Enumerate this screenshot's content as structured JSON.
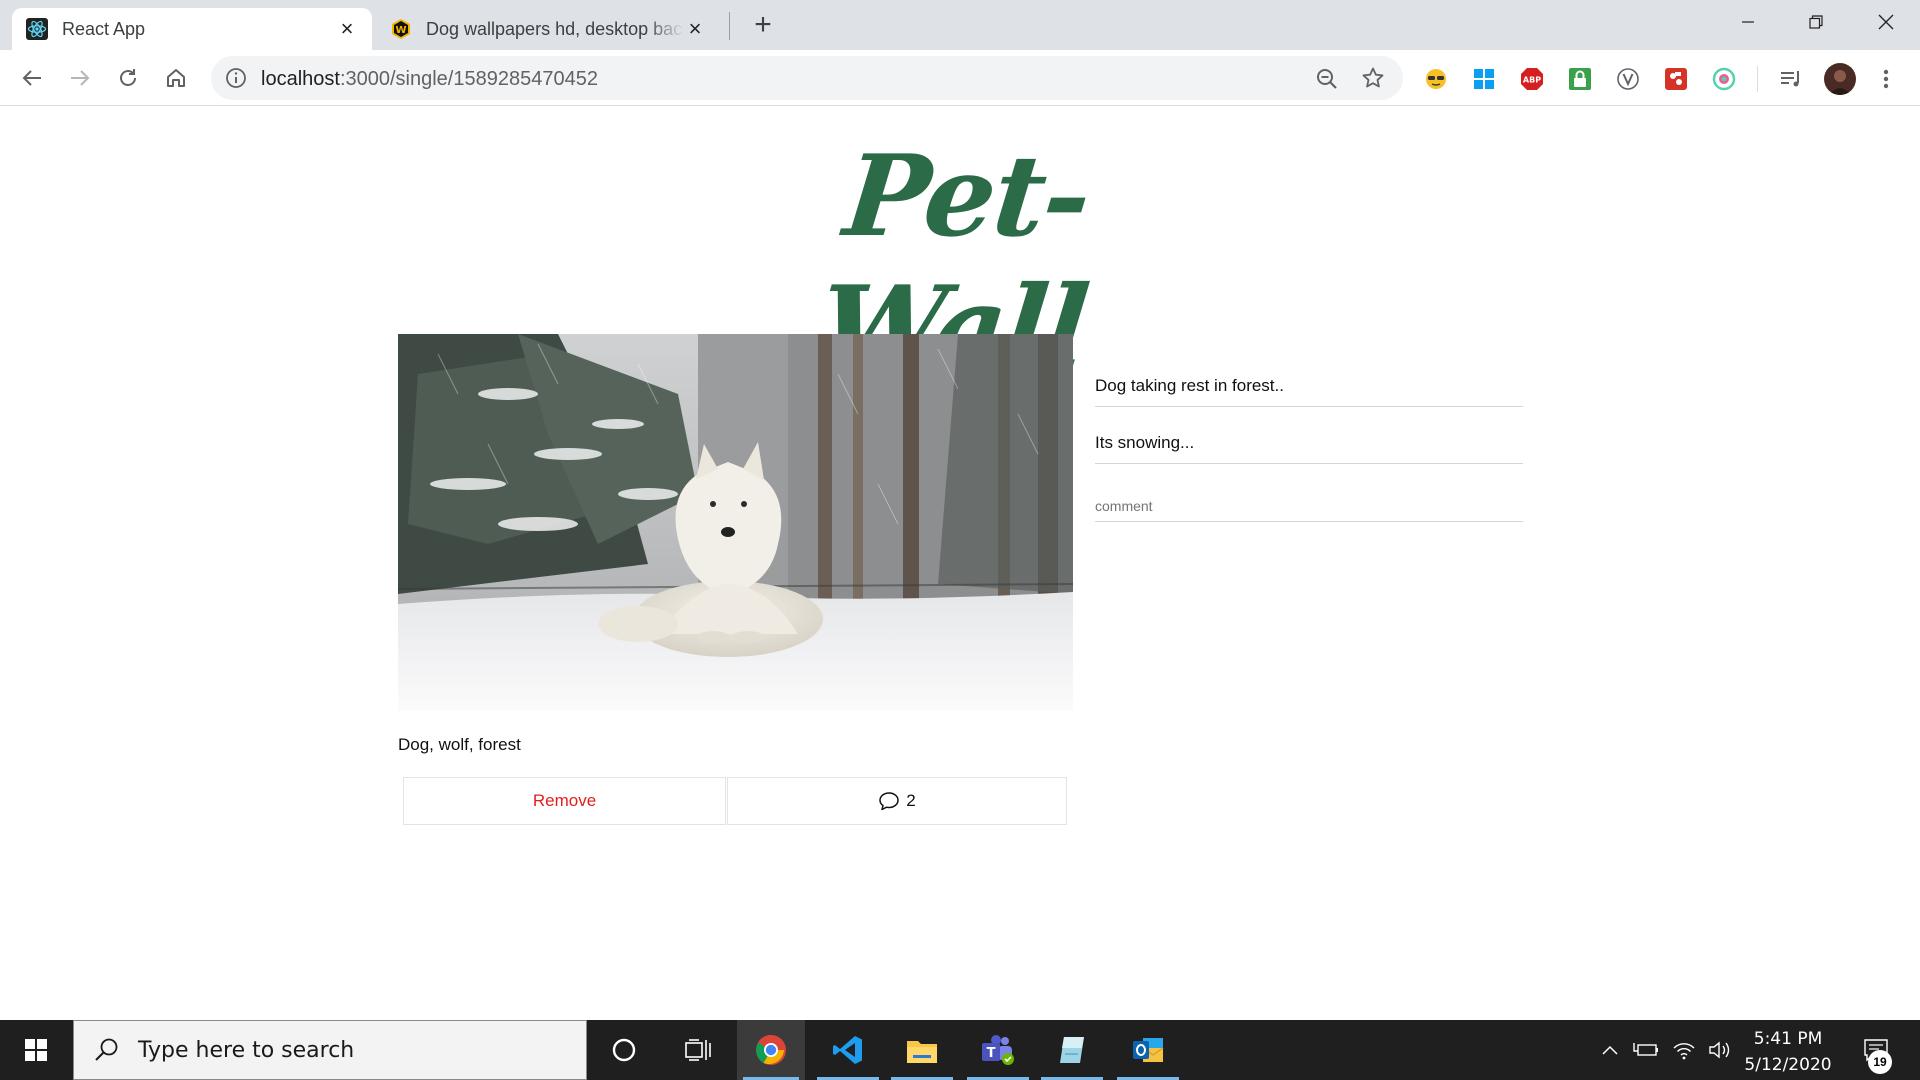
{
  "browser": {
    "tabs": [
      {
        "title": "React App",
        "active": true,
        "favicon": "react-icon"
      },
      {
        "title": "Dog wallpapers hd, desktop backgrounds",
        "active": false,
        "favicon": "wallpapers-w-icon"
      }
    ],
    "url": {
      "host": "localhost",
      "rest": ":3000/single/1589285470452"
    },
    "extensions": [
      "glasses-icon",
      "windows-icon",
      "adblock-icon",
      "lock-icon",
      "v-icon",
      "puzzle-icon",
      "circle-ext-icon",
      "media-control-icon",
      "profile-avatar"
    ]
  },
  "page": {
    "logo": "Pet-Wall",
    "post": {
      "image_alt": "White wolf-like dog lying in the snow in a forest",
      "tags": "Dog, wolf, forest",
      "remove_label": "Remove",
      "comment_count": "2"
    },
    "comments": [
      {
        "text": "Dog taking rest in forest.."
      },
      {
        "text": "Its snowing..."
      }
    ],
    "comment_placeholder": "comment"
  },
  "taskbar": {
    "search_placeholder": "Type here to search",
    "time": "5:41 PM",
    "date": "5/12/2020",
    "notification_count": "19",
    "pinned": [
      "cortana-icon",
      "task-view-icon",
      "chrome-icon",
      "vscode-icon",
      "file-explorer-icon",
      "teams-icon",
      "notes-icon",
      "outlook-icon"
    ]
  },
  "colors": {
    "logo": "#2c6b48",
    "remove": "#e02020",
    "taskbar": "#1f1f1f",
    "tabstrip": "#dee1e6"
  }
}
